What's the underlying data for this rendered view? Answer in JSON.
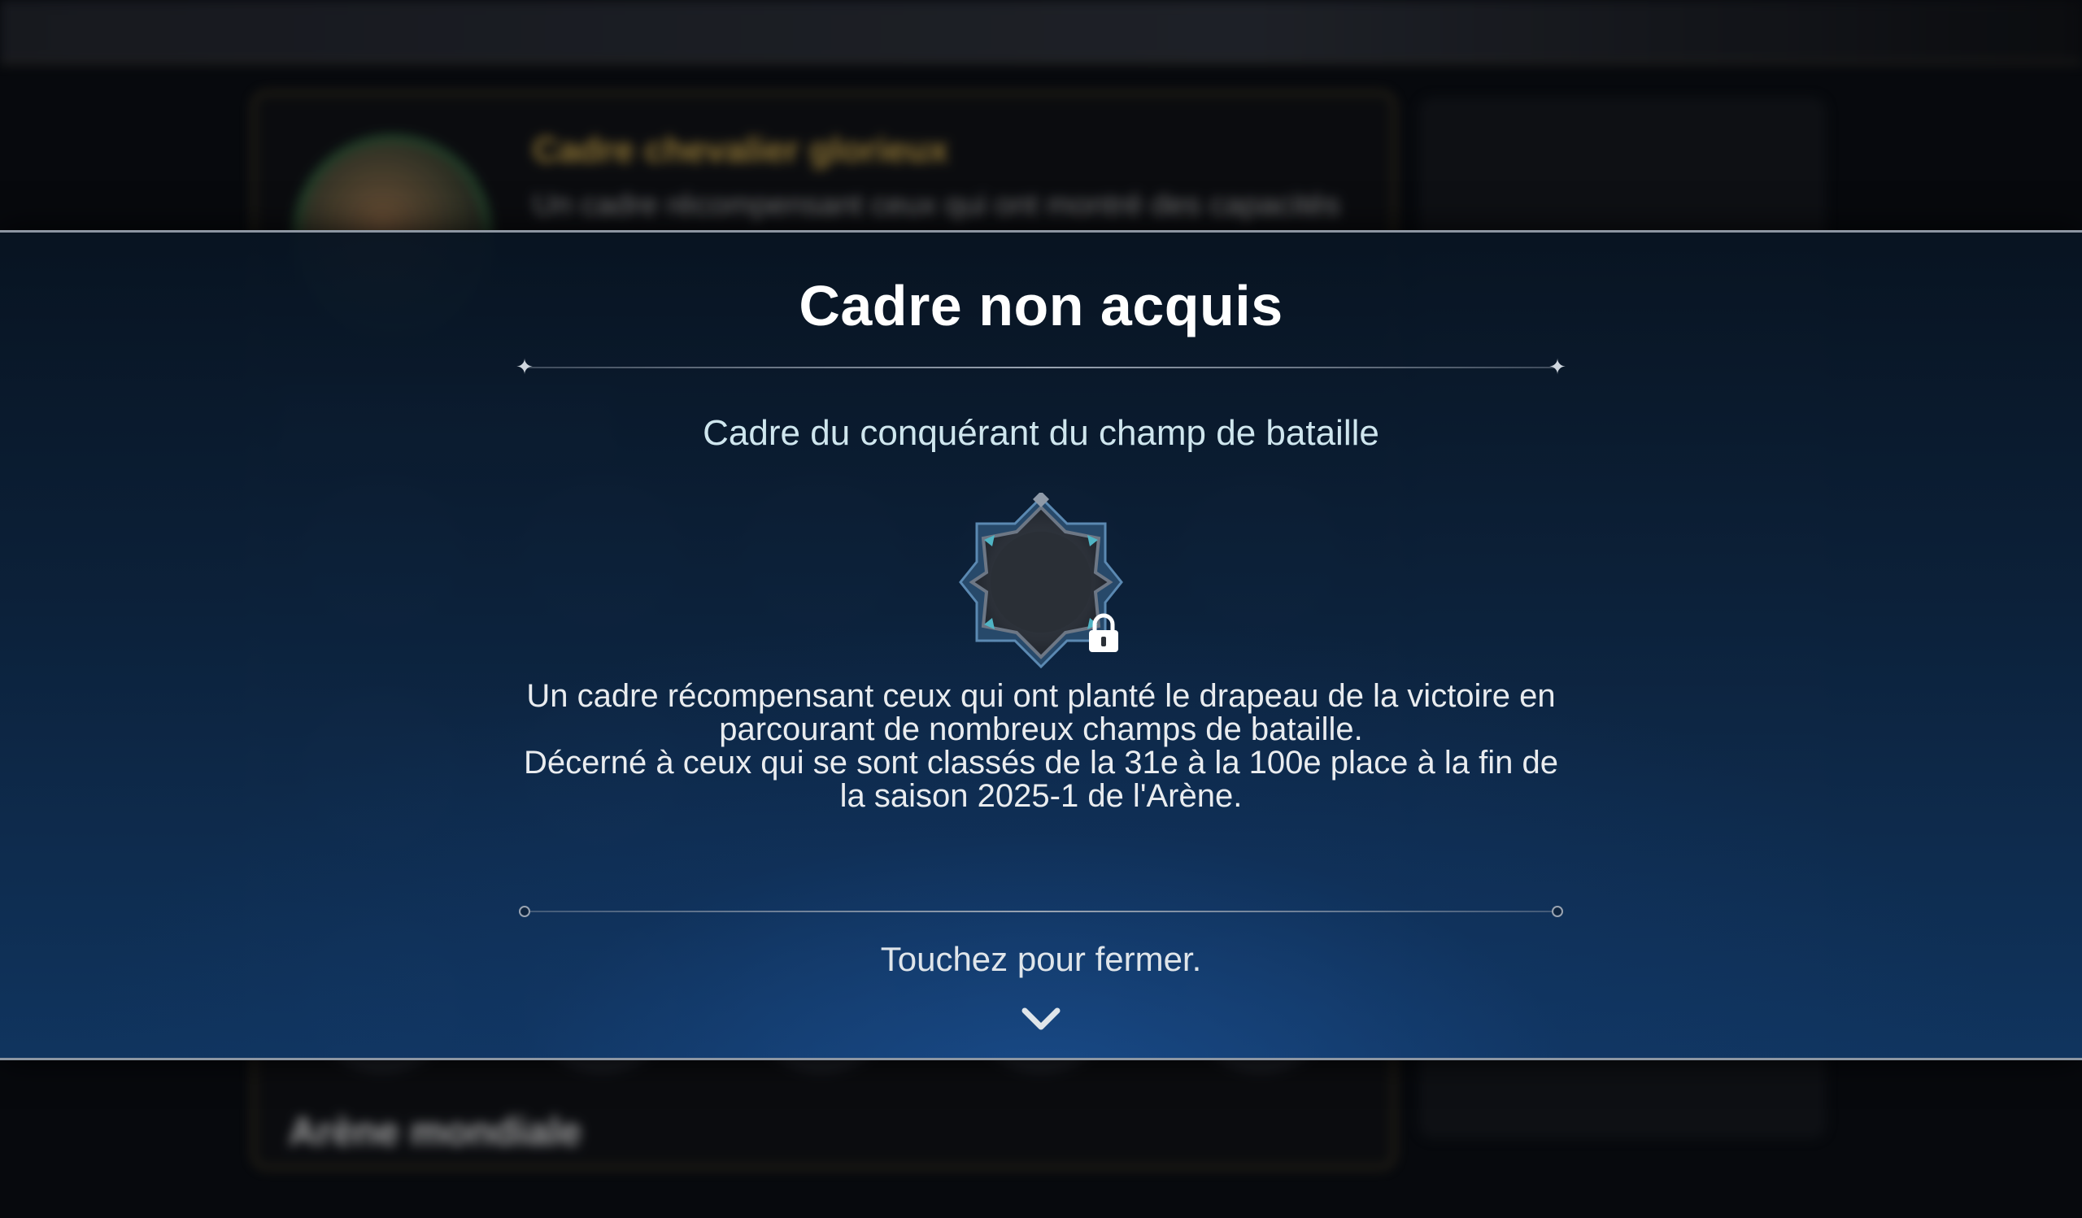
{
  "modal": {
    "title": "Cadre non acquis",
    "frame_name": "Cadre du conquérant du champ de bataille",
    "frame_icon": "star-frame-icon",
    "locked_icon": "lock-icon",
    "description_line1": "Un cadre récompensant ceux qui ont planté le drapeau de la victoire en parcourant de nombreux champs de bataille.",
    "description_line2": "Décerné à ceux qui se sont classés de la 31e à la 100e place à la fin de la saison 2025-1 de l'Arène.",
    "close_hint": "Touchez pour fermer.",
    "close_icon": "chevron-down-icon"
  },
  "background": {
    "selected_frame_title": "Cadre chevalier glorieux",
    "selected_frame_description": "Un cadre récompensant ceux qui ont montré des capacités",
    "section_title": "Arène mondiale"
  },
  "colors": {
    "modal_top": "#08141f",
    "modal_bottom": "#10365f",
    "title": "#ffffff",
    "frame_name": "#cfe6ee",
    "accent_gold": "#a8893c"
  }
}
